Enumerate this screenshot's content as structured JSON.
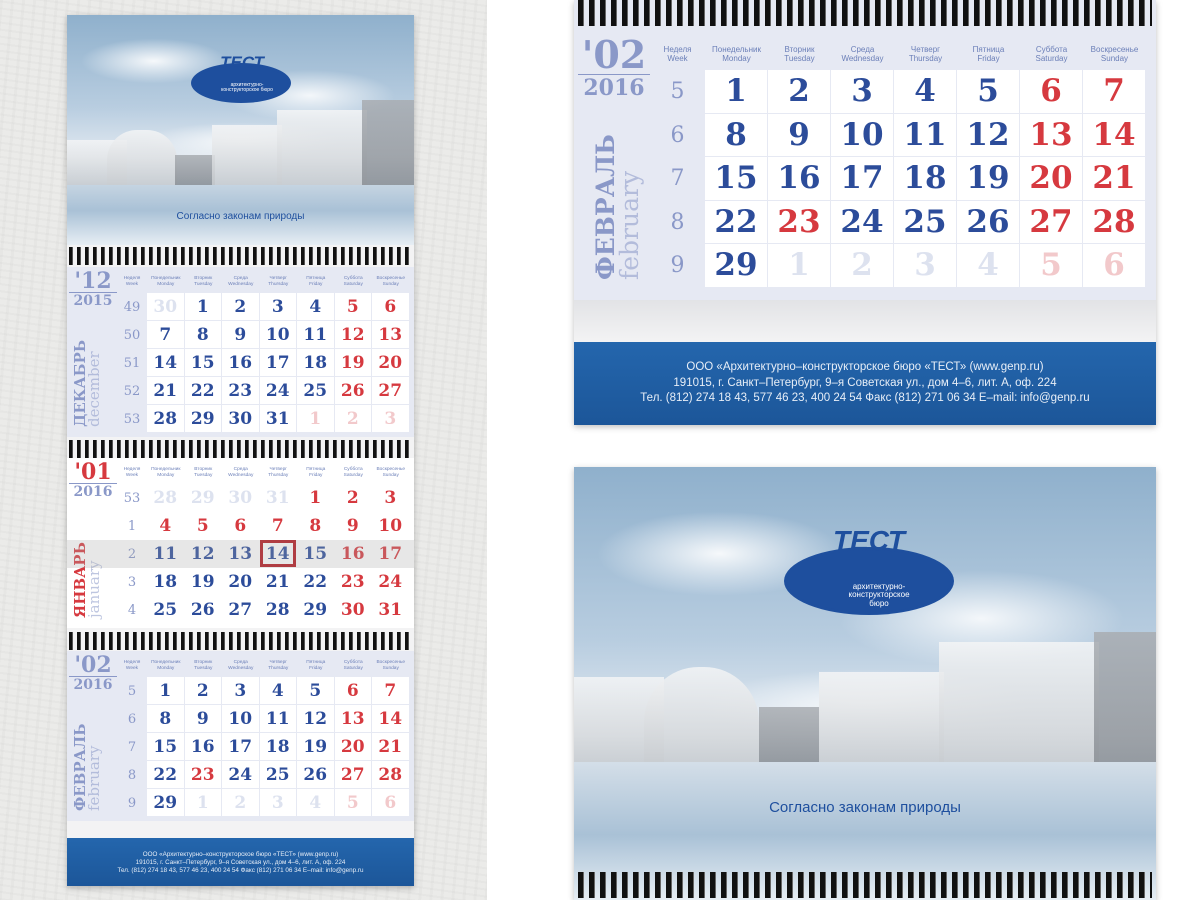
{
  "brand": {
    "logo_name": "ТЕСТ",
    "logo_sub": "архитектурно-конструкторское бюро",
    "tagline": "Согласно законам природы"
  },
  "weekday_headers": [
    [
      "Неделя",
      "Week"
    ],
    [
      "Понедельник",
      "Monday"
    ],
    [
      "Вторник",
      "Tuesday"
    ],
    [
      "Среда",
      "Wednesday"
    ],
    [
      "Четверг",
      "Thursday"
    ],
    [
      "Пятница",
      "Friday"
    ],
    [
      "Суббота",
      "Saturday"
    ],
    [
      "Воскресенье",
      "Sunday"
    ]
  ],
  "footer": {
    "line1": "ООО «Архитектурно–конструкторское бюро «ТЕСТ» (www.genp.ru)",
    "line2": "191015, г. Санкт–Петербург, 9–я Советская ул., дом 4–6, лит. А, оф. 224",
    "line3": "Тел. (812) 274 18 43, 577 46 23, 400 24 54 Факс (812) 271 06 34 E–mail: info@genp.ru"
  },
  "months": {
    "dec": {
      "num": "'12",
      "year": "2015",
      "ru": "ДЕКАБРЬ",
      "en": "december",
      "accent": "#8a98c8",
      "ruColor": "#8a98c8",
      "rows": [
        {
          "week": "49",
          "days": [
            30,
            1,
            2,
            3,
            4,
            5,
            6
          ],
          "style": "owwwwhh"
        },
        {
          "week": "50",
          "days": [
            7,
            8,
            9,
            10,
            11,
            12,
            13
          ],
          "style": "wwwwwhh"
        },
        {
          "week": "51",
          "days": [
            14,
            15,
            16,
            17,
            18,
            19,
            20
          ],
          "style": "wwwwwhh"
        },
        {
          "week": "52",
          "days": [
            21,
            22,
            23,
            24,
            25,
            26,
            27
          ],
          "style": "wwwwwhh"
        },
        {
          "week": "53",
          "days": [
            28,
            29,
            30,
            31,
            1,
            2,
            3
          ],
          "style": "wwwwXXX"
        }
      ]
    },
    "jan": {
      "num": "'01",
      "year": "2016",
      "ru": "ЯНВАРЬ",
      "en": "january",
      "accent": "#d6393f",
      "ruColor": "#d6393f",
      "highlight_row": 2,
      "today": 14,
      "rows": [
        {
          "week": "53",
          "days": [
            28,
            29,
            30,
            31,
            1,
            2,
            3
          ],
          "style": "oooohhh"
        },
        {
          "week": "1",
          "days": [
            4,
            5,
            6,
            7,
            8,
            9,
            10
          ],
          "style": "hhhhhhh"
        },
        {
          "week": "2",
          "days": [
            11,
            12,
            13,
            14,
            15,
            16,
            17
          ],
          "style": "wwwwwhh"
        },
        {
          "week": "3",
          "days": [
            18,
            19,
            20,
            21,
            22,
            23,
            24
          ],
          "style": "wwwwwhh"
        },
        {
          "week": "4",
          "days": [
            25,
            26,
            27,
            28,
            29,
            30,
            31
          ],
          "style": "wwwwwhh"
        }
      ]
    },
    "feb": {
      "num": "'02",
      "year": "2016",
      "ru": "ФЕВРАЛЬ",
      "en": "february",
      "accent": "#8a98c8",
      "ruColor": "#8a98c8",
      "rows": [
        {
          "week": "5",
          "days": [
            1,
            2,
            3,
            4,
            5,
            6,
            7
          ],
          "style": "wwwwwhh"
        },
        {
          "week": "6",
          "days": [
            8,
            9,
            10,
            11,
            12,
            13,
            14
          ],
          "style": "wwwwwhh"
        },
        {
          "week": "7",
          "days": [
            15,
            16,
            17,
            18,
            19,
            20,
            21
          ],
          "style": "wwwwwhh"
        },
        {
          "week": "8",
          "days": [
            22,
            23,
            24,
            25,
            26,
            27,
            28
          ],
          "style": "whwwwhh"
        },
        {
          "week": "9",
          "days": [
            29,
            1,
            2,
            3,
            4,
            5,
            6
          ],
          "style": "woooo XX"
        }
      ]
    }
  }
}
